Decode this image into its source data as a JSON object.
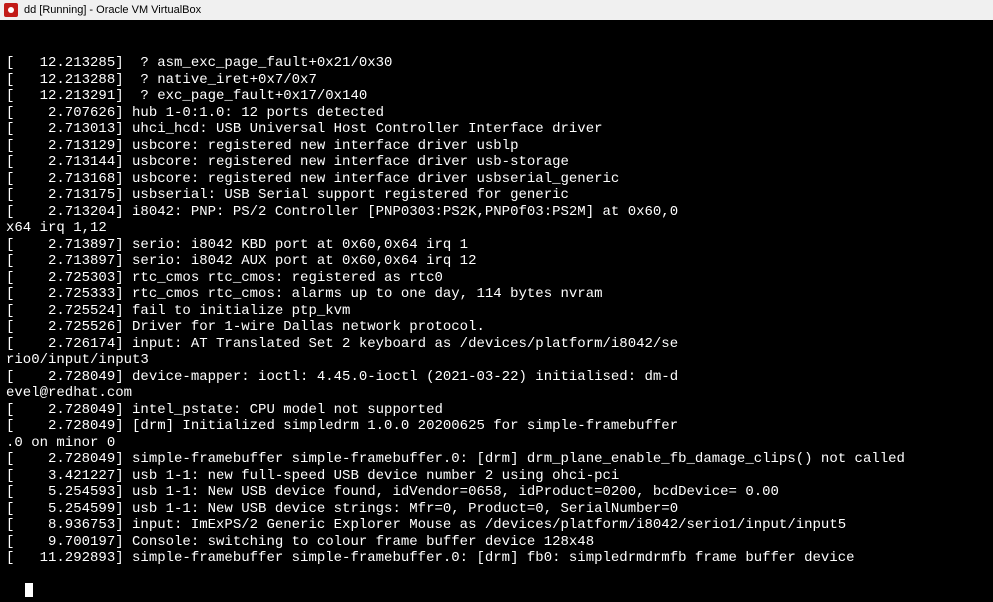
{
  "window": {
    "title": "dd [Running] - Oracle VM VirtualBox"
  },
  "logs": [
    "[   12.213285]  ? asm_exc_page_fault+0x21/0x30",
    "[   12.213288]  ? native_iret+0x7/0x7",
    "[   12.213291]  ? exc_page_fault+0x17/0x140",
    "[    2.707626] hub 1-0:1.0: 12 ports detected",
    "[    2.713013] uhci_hcd: USB Universal Host Controller Interface driver",
    "[    2.713129] usbcore: registered new interface driver usblp",
    "[    2.713144] usbcore: registered new interface driver usb-storage",
    "[    2.713168] usbcore: registered new interface driver usbserial_generic",
    "[    2.713175] usbserial: USB Serial support registered for generic",
    "[    2.713204] i8042: PNP: PS/2 Controller [PNP0303:PS2K,PNP0f03:PS2M] at 0x60,0",
    "x64 irq 1,12",
    "[    2.713897] serio: i8042 KBD port at 0x60,0x64 irq 1",
    "[    2.713897] serio: i8042 AUX port at 0x60,0x64 irq 12",
    "[    2.725303] rtc_cmos rtc_cmos: registered as rtc0",
    "[    2.725333] rtc_cmos rtc_cmos: alarms up to one day, 114 bytes nvram",
    "[    2.725524] fail to initialize ptp_kvm",
    "[    2.725526] Driver for 1-wire Dallas network protocol.",
    "[    2.726174] input: AT Translated Set 2 keyboard as /devices/platform/i8042/se",
    "rio0/input/input3",
    "[    2.728049] device-mapper: ioctl: 4.45.0-ioctl (2021-03-22) initialised: dm-d",
    "evel@redhat.com",
    "[    2.728049] intel_pstate: CPU model not supported",
    "[    2.728049] [drm] Initialized simpledrm 1.0.0 20200625 for simple-framebuffer",
    ".0 on minor 0",
    "[    2.728049] simple-framebuffer simple-framebuffer.0: [drm] drm_plane_enable_fb_damage_clips() not called",
    "[    3.421227] usb 1-1: new full-speed USB device number 2 using ohci-pci",
    "[    5.254593] usb 1-1: New USB device found, idVendor=0658, idProduct=0200, bcdDevice= 0.00",
    "[    5.254599] usb 1-1: New USB device strings: Mfr=0, Product=0, SerialNumber=0",
    "[    8.936753] input: ImExPS/2 Generic Explorer Mouse as /devices/platform/i8042/serio1/input/input5",
    "[    9.700197] Console: switching to colour frame buffer device 128x48",
    "[   11.292893] simple-framebuffer simple-framebuffer.0: [drm] fb0: simpledrmdrmfb frame buffer device"
  ]
}
